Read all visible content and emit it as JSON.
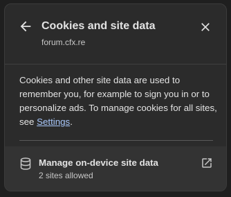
{
  "header": {
    "title": "Cookies and site data",
    "domain": "forum.cfx.re"
  },
  "description": {
    "text": "Cookies and other site data are used to remember you, for example to sign you in or to personalize ads. To manage cookies for all sites, see ",
    "link_label": "Settings",
    "trailing": "."
  },
  "manage": {
    "label": "Manage on-device site data",
    "sublabel": "2 sites allowed"
  },
  "icons": {
    "back": "back-arrow-icon",
    "close": "close-icon",
    "database": "database-icon",
    "open_external": "open-external-icon"
  },
  "colors": {
    "background": "#2b2b2b",
    "section": "#333333",
    "text": "#e3e3e3",
    "link": "#a8c7fa"
  }
}
